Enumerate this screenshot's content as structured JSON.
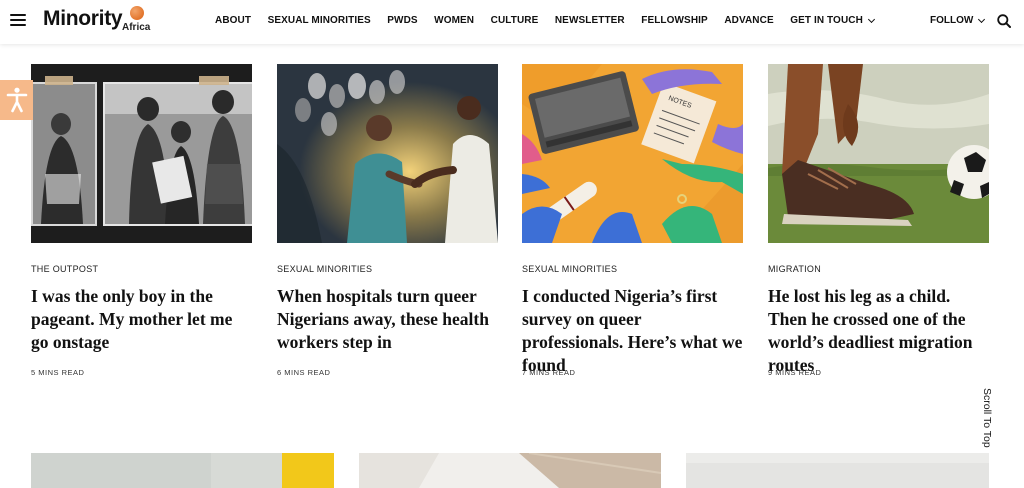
{
  "header": {
    "logo": {
      "main": "Minority",
      "sub": "Africa"
    },
    "nav": [
      "ABOUT",
      "SEXUAL MINORITIES",
      "PWDS",
      "WOMEN",
      "CULTURE",
      "NEWSLETTER",
      "FELLOWSHIP",
      "ADVANCE",
      "GET IN TOUCH"
    ],
    "follow": "FOLLOW",
    "icons": {
      "menu": "hamburger-menu-icon",
      "search": "search-icon",
      "dropdown": "chevron-down-icon"
    }
  },
  "accessibility": {
    "icon": "accessibility-icon",
    "color": "#f6b98a"
  },
  "articles": [
    {
      "category": "THE OUTPOST",
      "title": "I was the only boy in the pageant. My mother let me go onstage",
      "read_time": "5 MINS READ"
    },
    {
      "category": "SEXUAL MINORITIES",
      "title": "When hospitals turn queer Nigerians away, these health workers step in",
      "read_time": "6 MINS READ"
    },
    {
      "category": "SEXUAL MINORITIES",
      "title": "I conducted Nigeria’s first survey on queer professionals. Here’s what we found",
      "read_time": "7 MINS READ"
    },
    {
      "category": "MIGRATION",
      "title": "He lost his leg as a child. Then he crossed one of the world’s deadliest migration routes",
      "read_time": "9 MINS READ"
    }
  ],
  "illustration_labels": {
    "notes": "NOTES"
  },
  "scroll_to_top": "Scroll To Top",
  "colors": {
    "accent": "#e2742b",
    "text": "#111111"
  }
}
